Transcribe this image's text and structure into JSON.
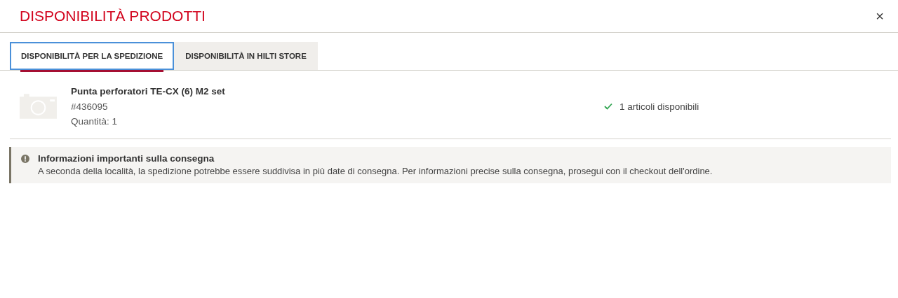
{
  "window": {
    "title": "DISPONIBILITÀ PRODOTTI",
    "close": "×"
  },
  "tabs": [
    {
      "label": "DISPONIBILITÀ PER LA SPEDIZIONE",
      "selected": true
    },
    {
      "label": "DISPONIBILITÀ IN HILTI STORE",
      "selected": false
    }
  ],
  "product": {
    "name": "Punta perforatori TE-CX (6) M2 set",
    "code": "#436095",
    "quantity": "Quantità: 1",
    "availability": "1 articoli disponibili",
    "available": true
  },
  "notice": {
    "title": "Informazioni importanti sulla consegna",
    "text": "A seconda della località, la spedizione potrebbe essere suddivisa in più date di consegna. Per informazioni precise sulla consegna, prosegui con il checkout dell'ordine."
  }
}
